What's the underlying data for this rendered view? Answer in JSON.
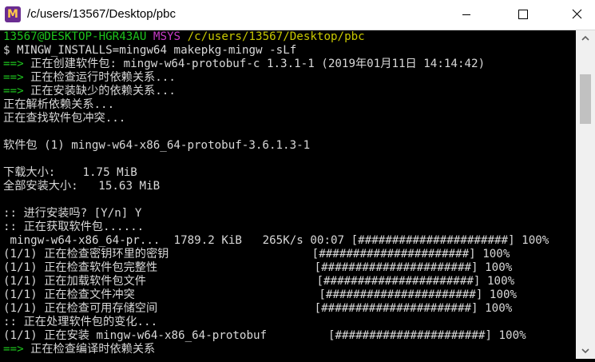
{
  "window": {
    "title": "/c/users/13567/Desktop/pbc",
    "icon_name": "msys2-icon",
    "buttons": [
      "minimize-icon",
      "maximize-icon",
      "close-icon"
    ]
  },
  "terminal": {
    "colors": {
      "green": "#1ec41e",
      "magenta": "#c73ac7",
      "yellow": "#c8c800",
      "text": "#d8d8d8",
      "background": "#000000"
    },
    "prompt": {
      "user_host": "13567@DESKTOP-HGR43AU",
      "shell": "MSYS",
      "path": "/c/users/13567/Desktop/pbc"
    },
    "lines": [
      "$ MINGW_INSTALLS=mingw64 makepkg-mingw -sLf",
      "==> ",
      "正在创建软件包: mingw-w64-protobuf-c 1.3.1-1 (2019年01月11日 14:14:42)",
      "==> ",
      "正在检查运行时依赖关系...",
      "==> ",
      "正在安装缺少的依赖关系...",
      "正在解析依赖关系...",
      "正在查找软件包冲突...",
      "软件包 (1) mingw-w64-x86_64-protobuf-3.6.1.3-1",
      "下载大小:    1.75 MiB",
      "全部安装大小:   15.63 MiB",
      ":: 进行安装吗? [Y/n] Y",
      ":: 正在获取软件包......",
      " mingw-w64-x86_64-pr...  1789.2 KiB   265K/s 00:07 [######################] 100%",
      "(1/1) 正在检查密钥环里的密钥                     [######################] 100%",
      "(1/1) 正在检查软件包完整性                       [######################] 100%",
      "(1/1) 正在加载软件包文件                         [######################] 100%",
      "(1/1) 正在检查文件冲突                           [######################] 100%",
      "(1/1) 正在检查可用存储空间                       [######################] 100%",
      ":: 正在处理软件包的变化...",
      "(1/1) 正在安装 mingw-w64-x86_64-protobuf         [######################] 100%",
      "==> ",
      "正在检查编译时依赖关系"
    ]
  }
}
